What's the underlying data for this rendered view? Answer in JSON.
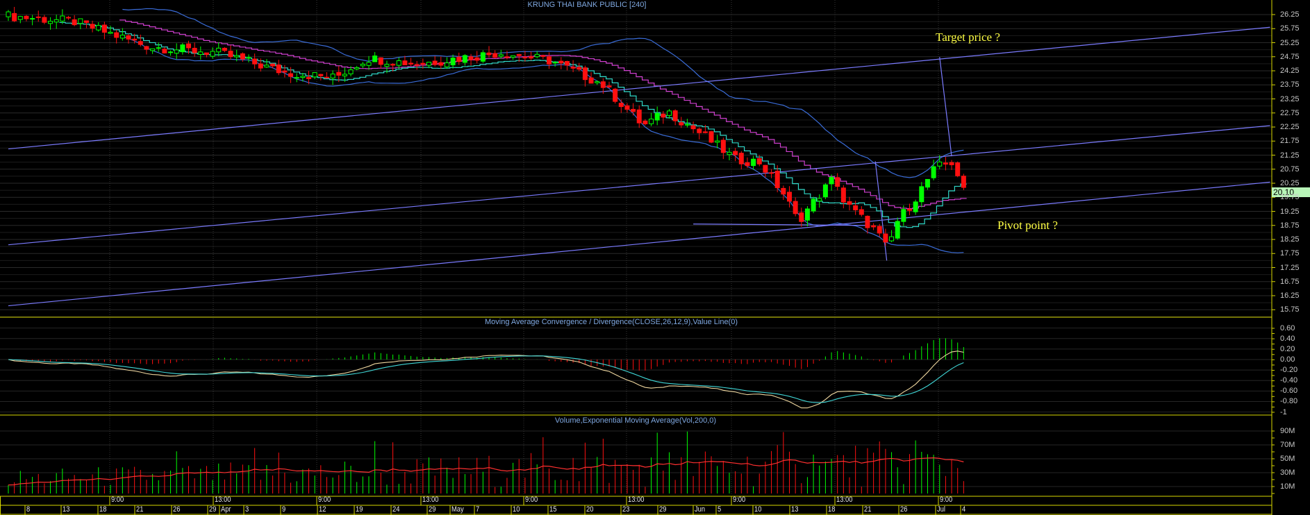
{
  "chart_data": {
    "type": "candlestick",
    "title": "KRUNG THAI BANK PUBLIC [240]",
    "last_price": "20.10",
    "price_axis": {
      "ticks": [
        "26.25",
        "25.75",
        "25.25",
        "24.75",
        "24.25",
        "23.75",
        "23.25",
        "22.75",
        "22.25",
        "21.75",
        "21.25",
        "20.75",
        "20.25",
        "19.75",
        "19.25",
        "18.75",
        "18.25",
        "17.75",
        "17.25",
        "16.75",
        "16.25",
        "15.75"
      ],
      "range": [
        15.75,
        26.25
      ]
    },
    "bar_count": 160,
    "close_keypoints": [
      [
        0,
        26.2
      ],
      [
        11,
        26.0
      ],
      [
        23.6,
        25.1
      ],
      [
        34.8,
        24.9
      ],
      [
        45.9,
        24.2
      ],
      [
        54.2,
        24.0
      ],
      [
        59.8,
        24.7
      ],
      [
        68.1,
        24.5
      ],
      [
        82,
        24.9
      ],
      [
        90.4,
        24.6
      ],
      [
        98.7,
        23.8
      ],
      [
        105.7,
        22.3
      ],
      [
        109.8,
        22.8
      ],
      [
        115.4,
        22.0
      ],
      [
        121,
        21.1
      ],
      [
        125.1,
        21.0
      ],
      [
        129.3,
        19.8
      ],
      [
        131.4,
        18.9
      ],
      [
        137.6,
        20.5
      ],
      [
        139,
        19.6
      ],
      [
        144.6,
        18.5
      ],
      [
        146.3,
        17.9
      ],
      [
        148,
        18.9
      ],
      [
        150.9,
        19.7
      ],
      [
        154.3,
        20.8
      ],
      [
        157.1,
        21.0
      ],
      [
        159,
        20.1
      ]
    ],
    "trendlines": [
      {
        "name": "channel-upper",
        "from": [
          0,
          21.47
        ],
        "to": [
          210,
          25.8
        ]
      },
      {
        "name": "channel-middle",
        "from": [
          0,
          18.06
        ],
        "to": [
          210,
          22.3
        ]
      },
      {
        "name": "channel-lower",
        "from": [
          0,
          15.89
        ],
        "to": [
          210,
          20.29
        ]
      },
      {
        "name": "target-projection",
        "from": [
          157,
          21.21
        ],
        "to": [
          155,
          24.74
        ]
      },
      {
        "name": "drop-line",
        "from": [
          144.3,
          21.03
        ],
        "to": [
          146.2,
          17.5
        ]
      },
      {
        "name": "pivot-segment",
        "from": [
          114,
          18.8
        ],
        "to": [
          143,
          18.75
        ]
      }
    ],
    "annotations": {
      "target": "Target price ?",
      "pivot": "Pivot point ?"
    },
    "indicators": {
      "bollinger_period": 20,
      "bollinger_k": 2,
      "ma_fast": 10,
      "ma_slow": 20
    },
    "macd": {
      "title": "Moving Average Convergence / Divergence(CLOSE,26,12,9),Value Line(0)",
      "ticks": [
        "0.60",
        "0.40",
        "0.20",
        "0.00",
        "-0.20",
        "-0.40",
        "-0.60",
        "-0.80",
        "-1"
      ],
      "range": [
        -1,
        0.6
      ],
      "slow": 26,
      "fast": 12,
      "signal": 9
    },
    "volume": {
      "title": "Volume,Exponential Moving Average(Vol,200,0)",
      "ticks": [
        "90M",
        "70M",
        "50M",
        "30M",
        "10M"
      ],
      "range_M": [
        0,
        100
      ],
      "ema_period": 200
    },
    "time_labels": [
      "9:00",
      "13:00",
      "9:00",
      "13:00",
      "9:00",
      "13:00",
      "9:00",
      "13:00",
      "9:00"
    ],
    "date_labels": [
      "8",
      "13",
      "18",
      "21",
      "26",
      "29",
      "Apr",
      "3",
      "9",
      "12",
      "19",
      "24",
      "29",
      "May",
      "7",
      "10",
      "15",
      "20",
      "23",
      "29",
      "Jun",
      "5",
      "10",
      "13",
      "18",
      "21",
      "26",
      "Jul",
      "4"
    ]
  },
  "colors": {
    "up": "#00ff00",
    "down": "#ff1010",
    "bands": "#3a6cd8",
    "ma_fast": "#d040d0",
    "ma_slow": "#30d8c8",
    "trend": "#7b7bff",
    "axis": "#d8d800"
  }
}
